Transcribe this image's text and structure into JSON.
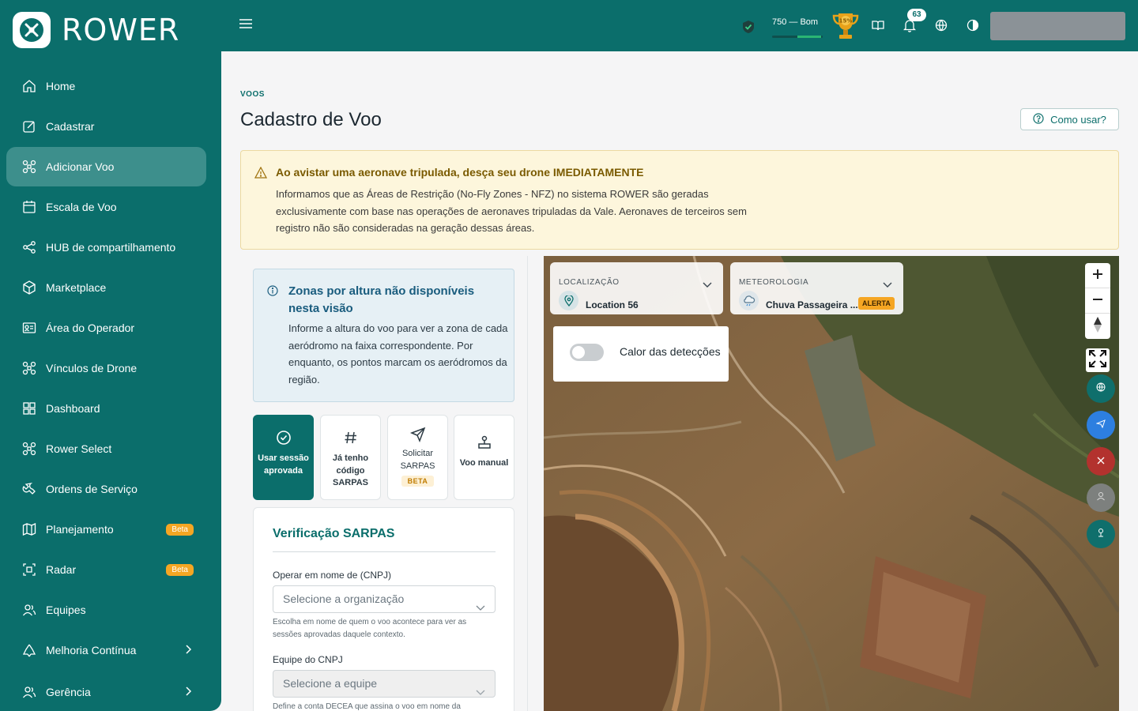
{
  "app": {
    "name": "ROWER"
  },
  "sidebar": {
    "items": [
      {
        "label": "Home",
        "icon": "home-icon"
      },
      {
        "label": "Cadastrar",
        "icon": "edit-icon"
      },
      {
        "label": "Adicionar Voo",
        "icon": "drone-icon",
        "active": true
      },
      {
        "label": "Escala de Voo",
        "icon": "calendar-icon"
      },
      {
        "label": "HUB de compartilhamento",
        "icon": "share-icon"
      },
      {
        "label": "Marketplace",
        "icon": "box-icon"
      },
      {
        "label": "Área do Operador",
        "icon": "id-card-icon"
      },
      {
        "label": "Vínculos de Drone",
        "icon": "drone-icon"
      },
      {
        "label": "Dashboard",
        "icon": "grid-icon"
      },
      {
        "label": "Rower Select",
        "icon": "drone-icon"
      },
      {
        "label": "Ordens de Serviço",
        "icon": "wrench-icon"
      },
      {
        "label": "Planejamento",
        "icon": "map-icon",
        "badge": "Beta"
      },
      {
        "label": "Radar",
        "icon": "radar-icon",
        "badge": "Beta"
      },
      {
        "label": "Equipes",
        "icon": "users-icon"
      },
      {
        "label": "Melhoria Contínua",
        "icon": "recycle-icon"
      },
      {
        "label": "Gerência",
        "icon": "users-icon"
      }
    ]
  },
  "header": {
    "score_text": "750 — Bom",
    "trophy_text": "15%",
    "notifications_count": "63"
  },
  "page": {
    "breadcrumb": "VOOS",
    "title": "Cadastro de Voo",
    "help_label": "Como usar?"
  },
  "warning": {
    "title": "Ao avistar uma aeronave tripulada, desça seu drone IMEDIATAMENTE",
    "body": "Informamos que as Áreas de Restrição (No-Fly Zones - NFZ) no sistema ROWER são geradas exclusivamente com base nas operações de aeronaves tripuladas da Vale. Aeronaves de terceiros sem registro não são consideradas na geração dessas áreas."
  },
  "info": {
    "title": "Zonas por altura não disponíveis nesta visão",
    "body": "Informe a altura do voo para ver a zona de cada aeródromo na faixa correspondente. Por enquanto, os pontos marcam os aeródromos da região."
  },
  "options": [
    {
      "label": "Usar sessão aprovada",
      "icon": "check-circle-icon",
      "active": true
    },
    {
      "label": "Já tenho código SARPAS",
      "icon": "hash-icon"
    },
    {
      "label": "Solicitar SARPAS",
      "icon": "send-icon",
      "badge": "BETA"
    },
    {
      "label": "Voo manual",
      "icon": "joystick-icon"
    }
  ],
  "form": {
    "title": "Verificação SARPAS",
    "cnpj_label": "Operar em nome de (CNPJ)",
    "cnpj_placeholder": "Selecione a organização",
    "cnpj_hint": "Escolha em nome de quem o voo acontece para ver as sessões aprovadas daquele contexto.",
    "team_label": "Equipe do CNPJ",
    "team_placeholder": "Selecione a equipe",
    "team_hint": "Define a conta DECEA que assina o voo em nome da"
  },
  "map": {
    "location_label": "LOCALIZAÇÃO",
    "location_value": "Location 56",
    "weather_label": "METEOROLOGIA",
    "weather_value": "Chuva Passageira ...",
    "weather_status": "ALERTA",
    "heat_label": "Calor das detecções",
    "heat_enabled": false
  },
  "colors": {
    "primary": "#0b6e6b",
    "beta": "#f5a623",
    "warning_bg": "#fdf6dc",
    "info_bg": "#e6f0f5"
  }
}
